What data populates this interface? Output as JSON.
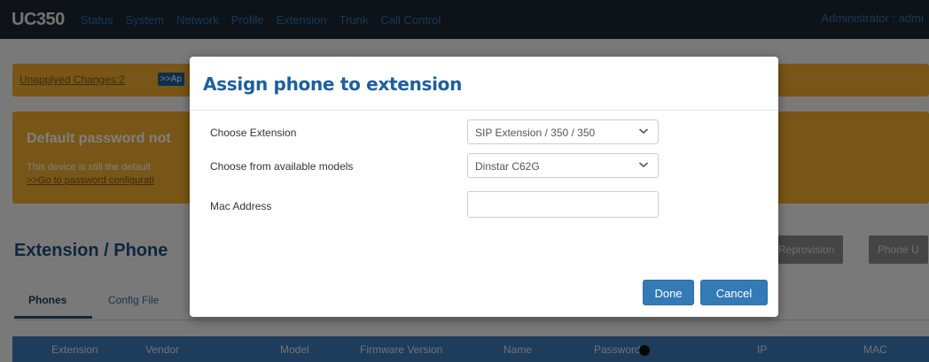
{
  "app": {
    "brand": "UC350",
    "nav": [
      "Status",
      "System",
      "Network",
      "Profile",
      "Extension",
      "Trunk",
      "Call Control"
    ],
    "user": "Administrator : admi"
  },
  "alert": {
    "link": "Unapplyed Changes:2",
    "apply": ">>Ap"
  },
  "warning": {
    "title": "Default password not",
    "text": "This device is still the default",
    "link": ">>Go to password configurati"
  },
  "page": {
    "title": "Extension / Phone",
    "buttons": [
      "Reprovision",
      "Phone U"
    ],
    "tabs": [
      "Phones",
      "Config File"
    ],
    "table_headers": [
      "Extension",
      "Vendor",
      "Model",
      "Firmware Version",
      "Name",
      "Password",
      "IP",
      "MAC"
    ]
  },
  "modal": {
    "title": "Assign phone to extension",
    "fields": {
      "extension": {
        "label": "Choose Extension",
        "value": "SIP Extension / 350 / 350"
      },
      "model": {
        "label": "Choose from available models",
        "value": "Dinstar C62G"
      },
      "mac": {
        "label": "Mac Address",
        "value": ""
      }
    },
    "done": "Done",
    "cancel": "Cancel"
  },
  "colors": {
    "accent": "#337ab7",
    "warning": "#f0ad2e",
    "nav_bg": "#1c2733",
    "title": "#1d5f9e"
  },
  "icons": [
    "chevron-down-icon",
    "eye-icon"
  ]
}
